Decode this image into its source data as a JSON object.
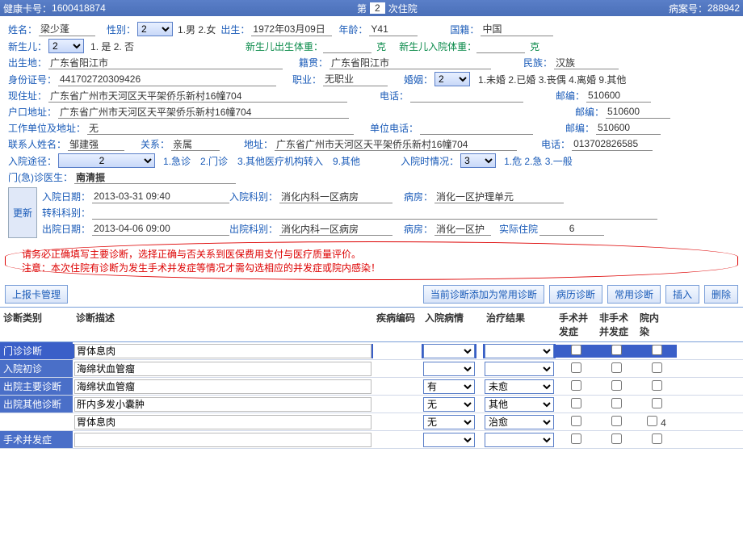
{
  "topbar": {
    "card_lbl": "健康卡号：",
    "card": "1600418874",
    "mid_pre": "第",
    "mid_num": "2",
    "mid_suf": "次住院",
    "rec_lbl": "病案号：",
    "rec": "288942"
  },
  "f": {
    "name_lbl": "姓名：",
    "name": "梁少蓬",
    "sex_lbl": "性别：",
    "sex": "2",
    "sex_opts": "1.男 2.女",
    "birth_lbl": "出生：",
    "birth": "1972年03月09日",
    "age_lbl": "年龄：",
    "age": "Y41",
    "nat_lbl": "国籍：",
    "nat": "中国",
    "nb_lbl": "新生儿：",
    "nb": "2",
    "nb_opts": "1. 是 2. 否",
    "nb_bw_lbl": "新生儿出生体重：",
    "nb_bw": "",
    "kg": "克",
    "nb_iw_lbl": "新生儿入院体重：",
    "nb_iw": "",
    "bp_lbl": "出生地：",
    "bp": "广东省阳江市",
    "jg_lbl": "籍贯：",
    "jg": "广东省阳江市",
    "mz_lbl": "民族：",
    "mz": "汉族",
    "id_lbl": "身份证号：",
    "id": "441702720309426",
    "job_lbl": "职业：",
    "job": "无职业",
    "mar_lbl": "婚姻：",
    "mar": "2",
    "mar_opts": "1.未婚 2.已婚 3.丧偶 4.离婚 9.其他",
    "addr1_lbl": "现住址：",
    "addr1": "广东省广州市天河区天平架侨乐新村16幢704",
    "tel_lbl": "电话：",
    "tel": "",
    "zip_lbl": "邮编：",
    "zip": "510600",
    "addr2_lbl": "户口地址：",
    "addr2": "广东省广州市天河区天平架侨乐新村16幢704",
    "zip2": "510600",
    "work_lbl": "工作单位及地址：",
    "work": "无",
    "worktel_lbl": "单位电话：",
    "worktel": "",
    "zip3": "510600",
    "ctc_lbl": "联系人姓名：",
    "ctc": "邹建强",
    "rel_lbl": "关系：",
    "rel": "亲属",
    "ctc_addr_lbl": "地址：",
    "ctc_addr": "广东省广州市天河区天平架侨乐新村16幢704",
    "ctc_tel_lbl": "电话：",
    "ctc_tel": "013702826585",
    "route_lbl": "入院途径：",
    "route": "2",
    "route_opts": "1.急诊　2.门诊　3.其他医疗机构转入　9.其他",
    "adm_stat_lbl": "入院时情况：",
    "adm_stat": "3",
    "adm_stat_opts": "1.危 2.急 3.一般",
    "op_doc_lbl": "门(急)诊医生：",
    "op_doc": "南清振",
    "upd_btn": "更新",
    "in_date_lbl": "入院日期：",
    "in_date": "2013-03-31 09:40",
    "in_dept_lbl": "入院科别：",
    "in_dept": "消化内科一区病房",
    "ward_lbl": "病房：",
    "in_ward": "消化一区护理单元",
    "xfer_lbl": "转科科别：",
    "xfer": "",
    "out_date_lbl": "出院日期：",
    "out_date": "2013-04-06 09:00",
    "out_dept_lbl": "出院科别：",
    "out_dept": "消化内科一区病房",
    "out_ward": "消化一区护",
    "los_lbl": "实际住院",
    "los": "6"
  },
  "warn": {
    "l1": "请务必正确填写主要诊断，选择正确与否关系到医保费用支付与医疗质量评价。",
    "l2": "注意：本次住院有诊断为发生手术并发症等情况才需勾选相应的并发症或院内感染！"
  },
  "btns": {
    "rpt": "上报卡管理",
    "addcom": "当前诊断添加为常用诊断",
    "hist": "病历诊断",
    "com": "常用诊断",
    "ins": "插入",
    "del": "删除"
  },
  "hdr": {
    "type": "诊断类别",
    "desc": "诊断描述",
    "icd": "疾病编码",
    "cond": "入院病情",
    "res": "治疗结果",
    "c1": "手术并\n发症",
    "c2": "非手术\n并发症",
    "c3": "院内\n染"
  },
  "rows": [
    {
      "type": "门诊诊断",
      "desc": "胃体息肉",
      "cond": "",
      "res": "",
      "sel": true
    },
    {
      "type": "入院初诊",
      "desc": "海绵状血管瘤",
      "cond": "",
      "res": ""
    },
    {
      "type": "出院主要诊断",
      "desc": "海绵状血管瘤",
      "cond": "有",
      "res": "未愈"
    },
    {
      "type": "出院其他诊断",
      "desc": "肝内多发小囊肿",
      "cond": "无",
      "res": "其他"
    },
    {
      "type": "",
      "desc": "胃体息肉",
      "cond": "无",
      "res": "治愈",
      "extra": "4"
    },
    {
      "type": "手术并发症",
      "desc": "",
      "cond": "",
      "res": ""
    }
  ]
}
